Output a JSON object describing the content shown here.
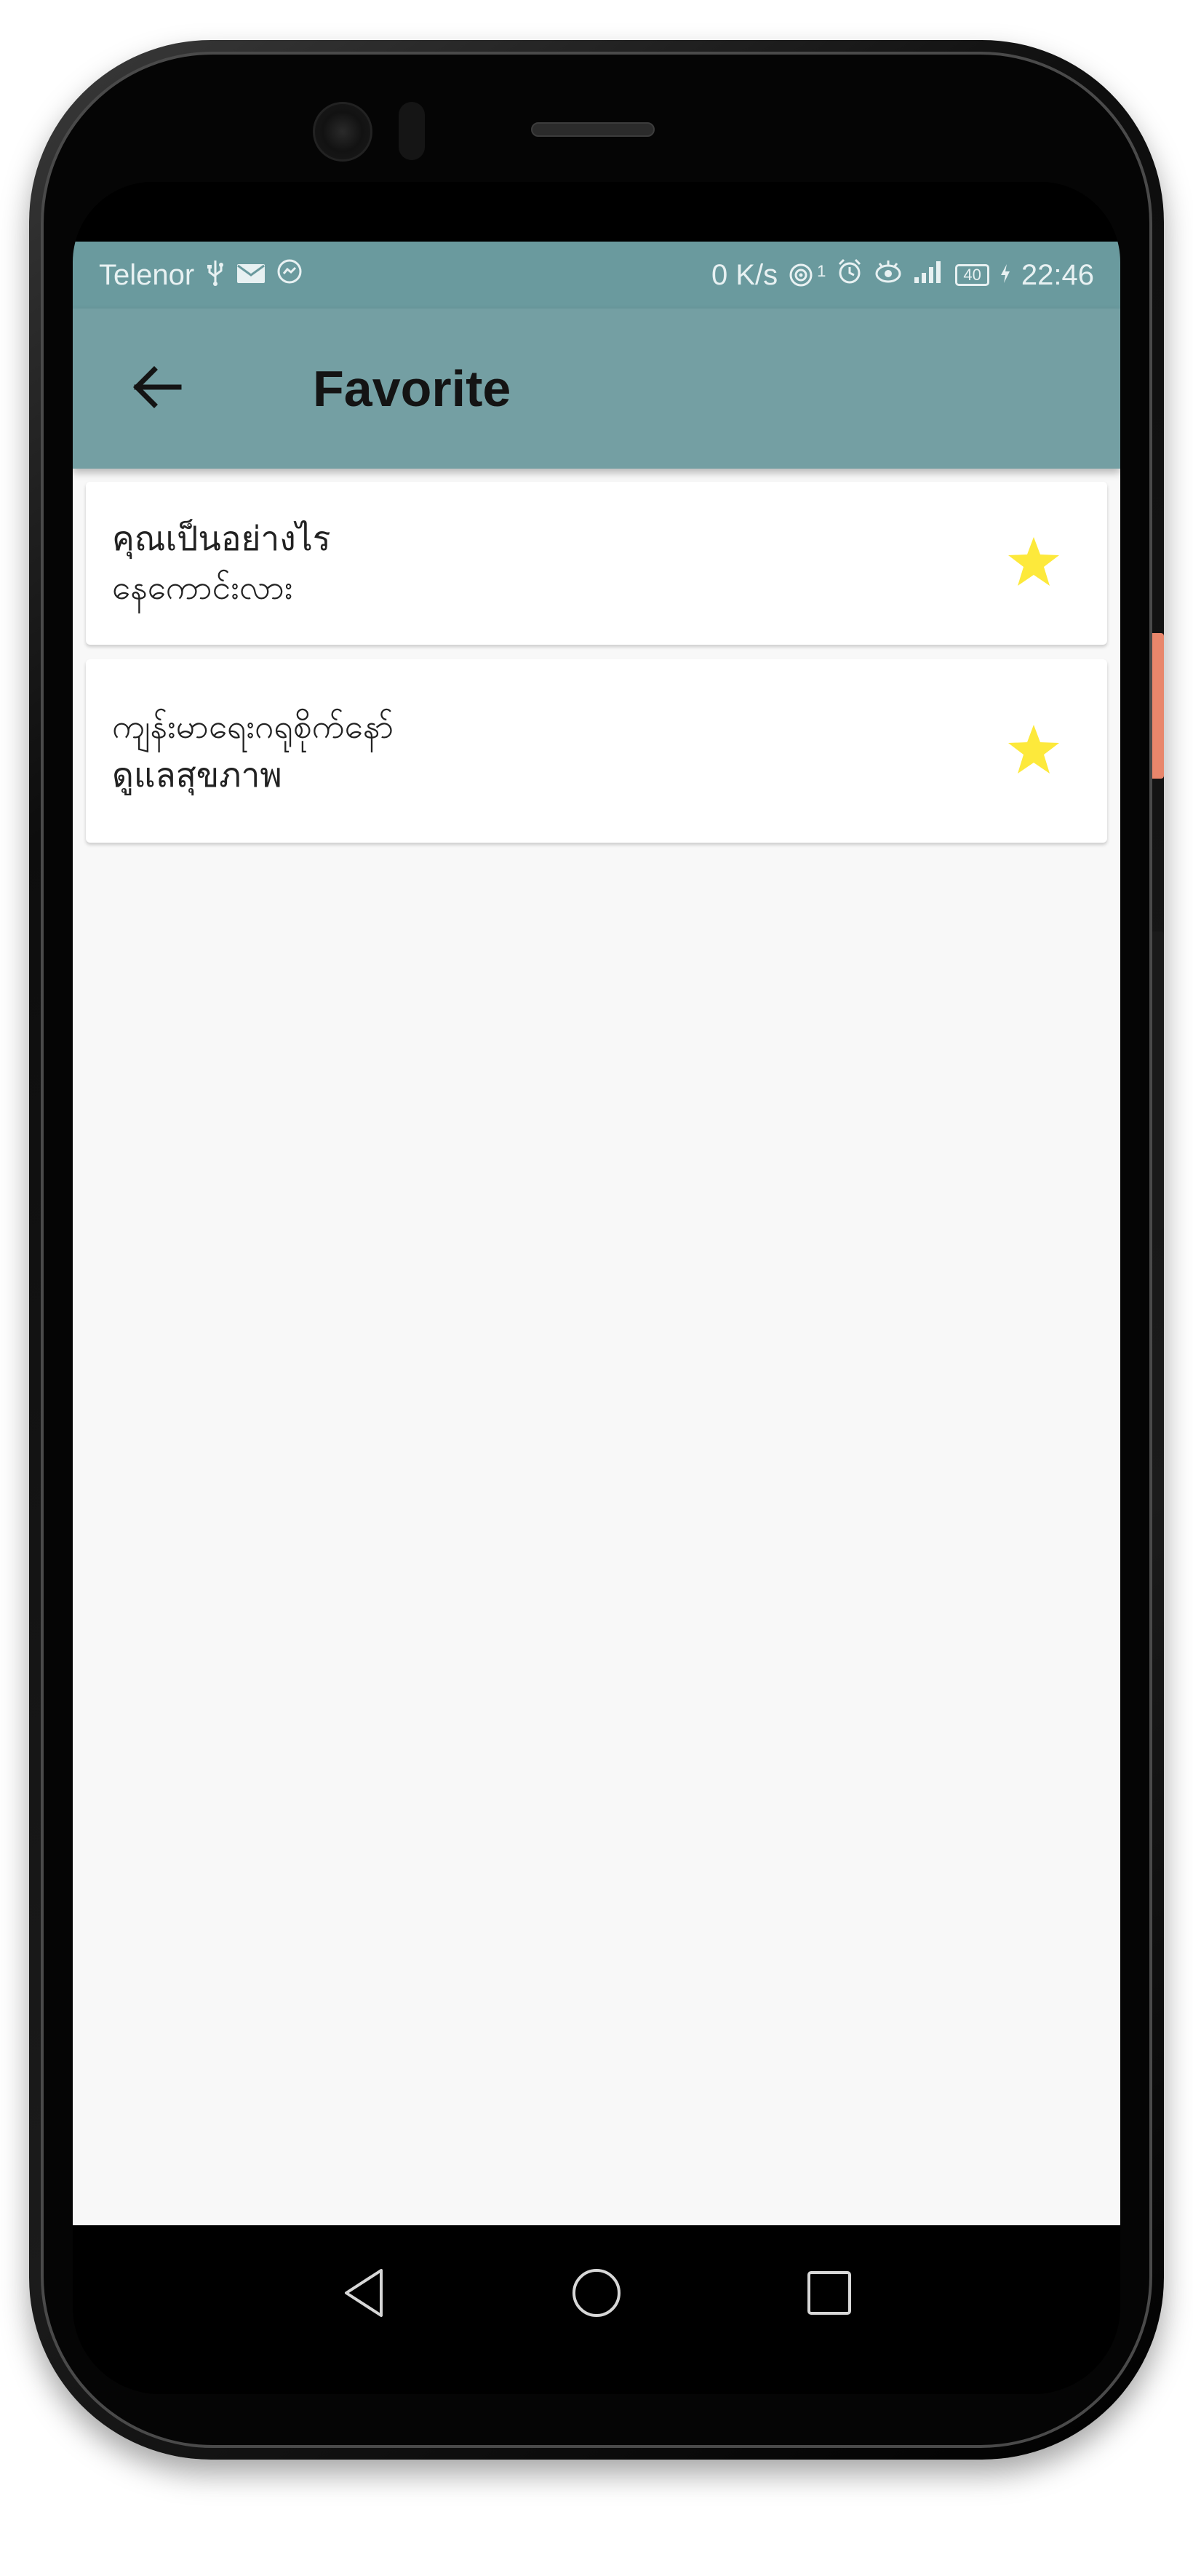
{
  "status_bar": {
    "carrier": "Telenor",
    "network_speed": "0 K/s",
    "signal_badge": "1",
    "battery_level": "40",
    "time": "22:46"
  },
  "app_bar": {
    "title": "Favorite",
    "back_icon": "arrow-left-icon"
  },
  "favorites": [
    {
      "line1": "คุณเป็นอย่างไร",
      "line2": "နေကောင်းလား",
      "starred": true
    },
    {
      "line1": "ကျန်းမာရေးဂရုစိုက်နော်",
      "line2": "ดูแลสุขภาพ",
      "starred": true
    }
  ],
  "colors": {
    "status_bar": "#6a9a9e",
    "app_bar": "#749fa3",
    "star": "#fde93b",
    "background": "#f8f8f8"
  },
  "nav": {
    "back_icon": "triangle-back-icon",
    "home_icon": "circle-home-icon",
    "recents_icon": "square-recents-icon"
  }
}
